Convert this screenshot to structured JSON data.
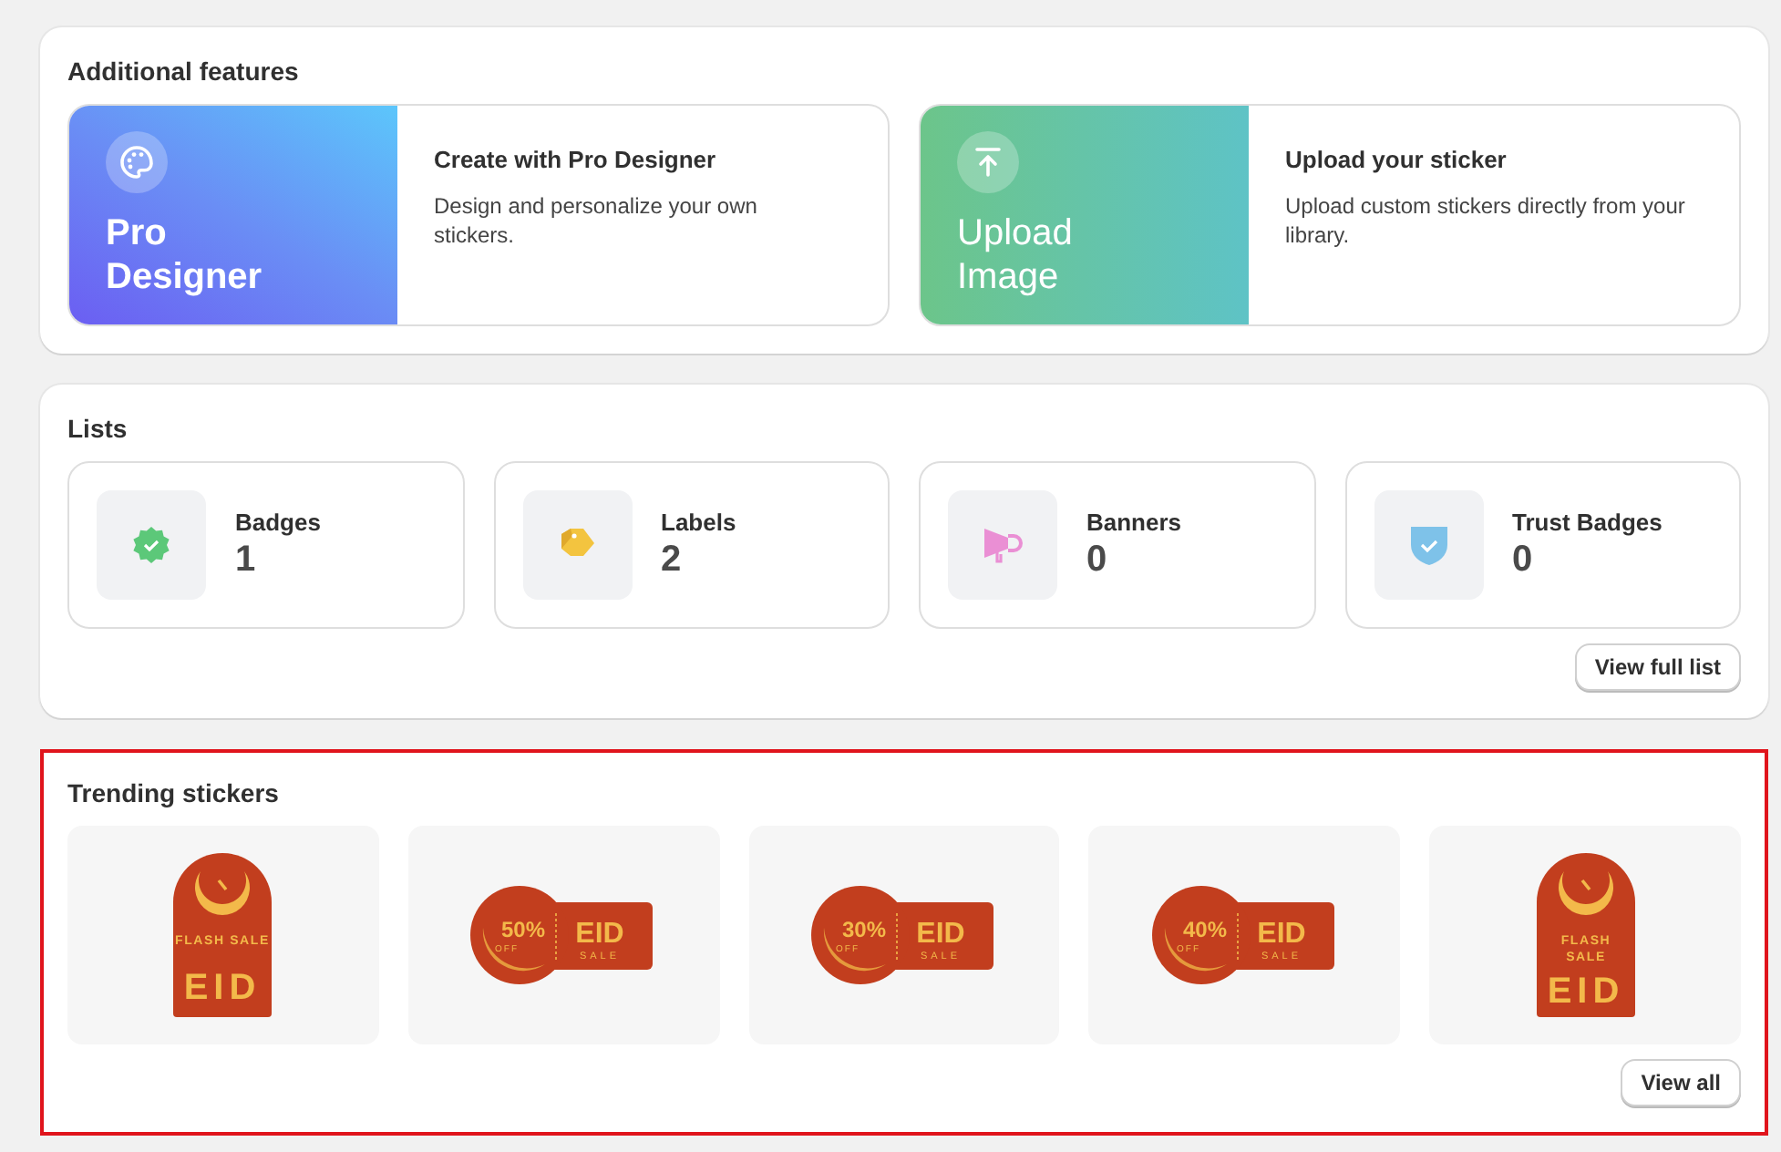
{
  "features": {
    "title": "Additional features",
    "cards": [
      {
        "kind": "designer",
        "hero_lines": [
          "Pro",
          "Designer"
        ],
        "title": "Create with Pro Designer",
        "description": "Design and personalize your own stickers."
      },
      {
        "kind": "upload",
        "hero_lines": [
          "Upload",
          "Image"
        ],
        "title": "Upload your sticker",
        "description": "Upload custom stickers directly from your library."
      }
    ]
  },
  "lists": {
    "title": "Lists",
    "items": [
      {
        "kind": "badge",
        "name": "Badges",
        "count": "1"
      },
      {
        "kind": "label",
        "name": "Labels",
        "count": "2"
      },
      {
        "kind": "banner",
        "name": "Banners",
        "count": "0"
      },
      {
        "kind": "trust",
        "name": "Trust Badges",
        "count": "0"
      }
    ],
    "button": "View full list"
  },
  "trending": {
    "title": "Trending stickers",
    "highlighted": true,
    "stickers": [
      {
        "kind": "tall",
        "lines": [
          "FLASH SALE"
        ],
        "main": "EID"
      },
      {
        "kind": "round",
        "percent": "50%",
        "off": "OFF",
        "main": "EID",
        "sub": "SALE"
      },
      {
        "kind": "round",
        "percent": "30%",
        "off": "OFF",
        "main": "EID",
        "sub": "SALE"
      },
      {
        "kind": "round",
        "percent": "40%",
        "off": "OFF",
        "main": "EID",
        "sub": "SALE"
      },
      {
        "kind": "tall",
        "lines": [
          "FLASH",
          "SALE"
        ],
        "main": "EID"
      }
    ],
    "button": "View all"
  }
}
